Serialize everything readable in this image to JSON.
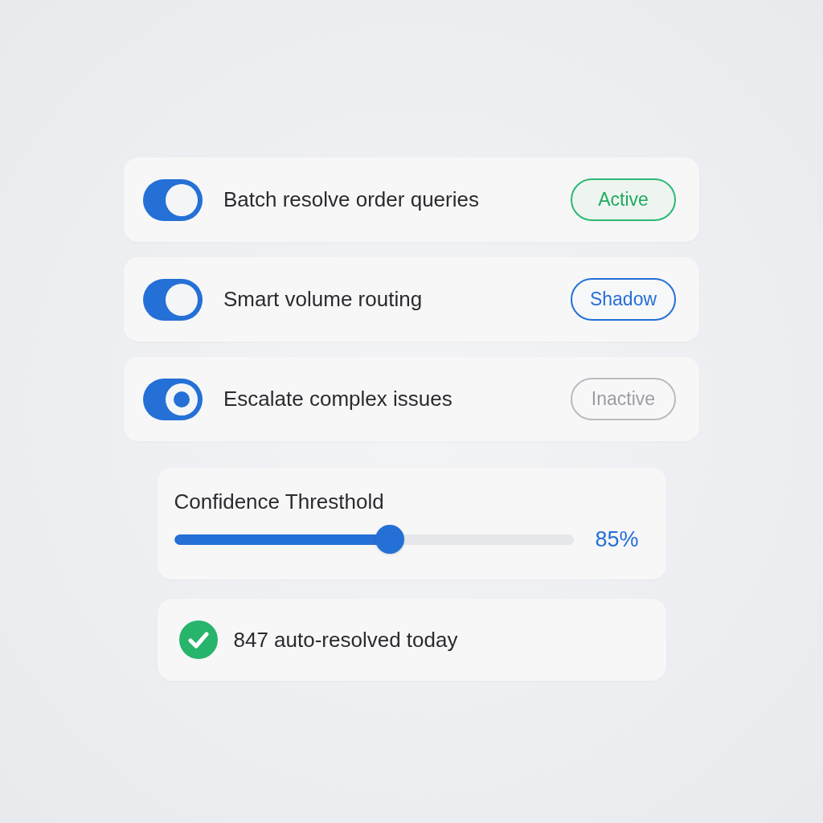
{
  "automations": [
    {
      "label": "Batch resolve order queries",
      "on": true,
      "dot": false,
      "status": {
        "label": "Active",
        "kind": "active"
      }
    },
    {
      "label": "Smart volume routing",
      "on": true,
      "dot": false,
      "status": {
        "label": "Shadow",
        "kind": "shadow"
      }
    },
    {
      "label": "Escalate complex issues",
      "on": true,
      "dot": true,
      "status": {
        "label": "Inactive",
        "kind": "inactive"
      }
    }
  ],
  "threshold": {
    "title": "Confidence Thresthold",
    "level": 0.54,
    "reading": "85%"
  },
  "summary": {
    "text": "847 auto-resolved today"
  }
}
